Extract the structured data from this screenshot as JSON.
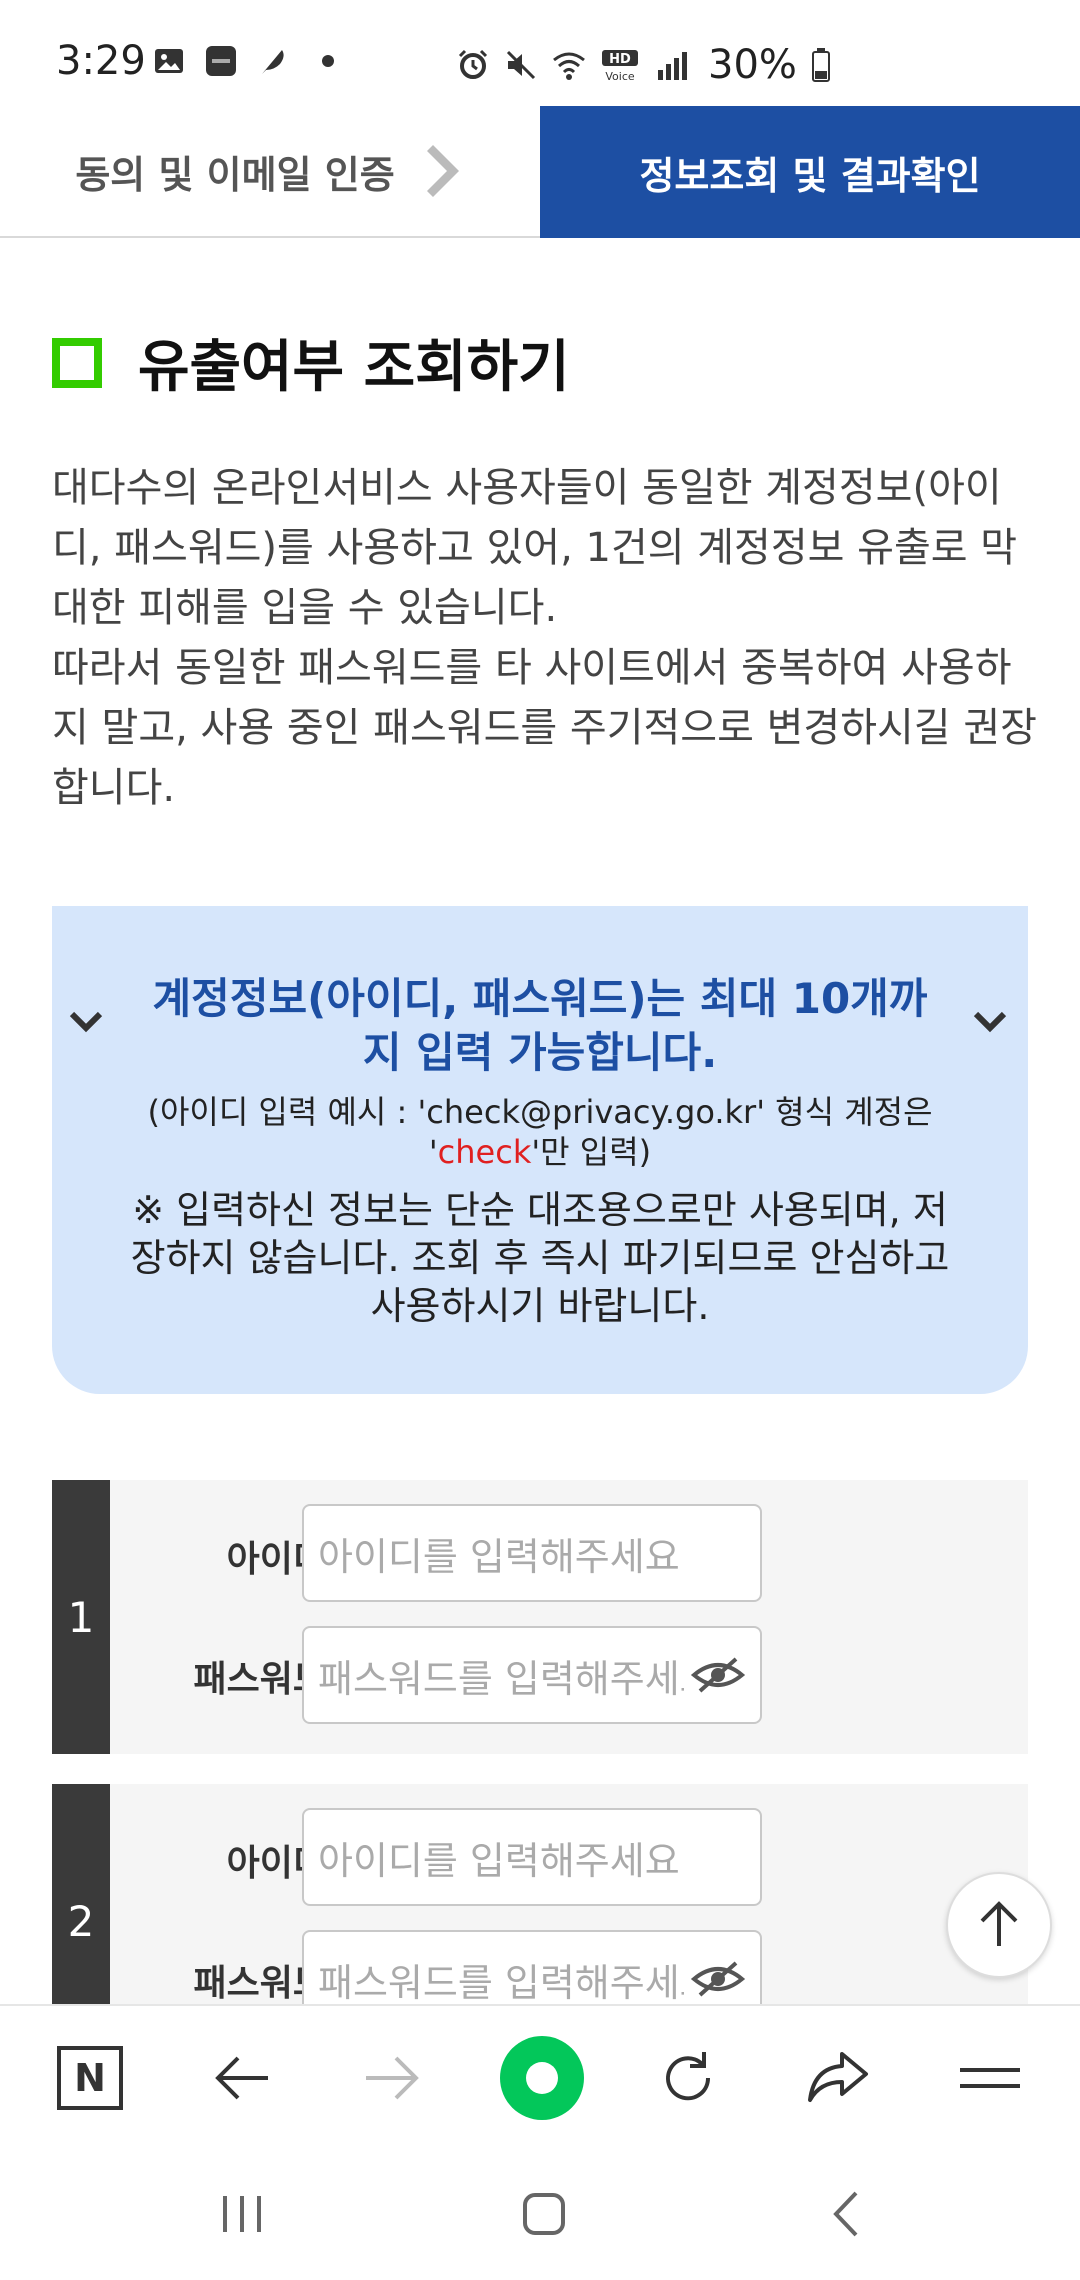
{
  "status_bar": {
    "time": "3:29",
    "battery": "30%",
    "hd_label": "HD",
    "voice_label": "Voice",
    "icons": [
      "gallery-icon",
      "ably-icon",
      "feather-icon",
      "dot-icon",
      "alarm-icon",
      "mute-icon",
      "wifi-icon",
      "hd-voice-icon",
      "signal-icon",
      "battery-icon"
    ]
  },
  "steps": {
    "step1_label": "동의 및 이메일 인증",
    "step2_label": "정보조회 및 결과확인"
  },
  "section": {
    "title": "유출여부 조회하기"
  },
  "description": {
    "paragraph1": "대다수의 온라인서비스 사용자들이 동일한 계정정보(아이디, 패스워드)를 사용하고 있어, 1건의 계정정보 유출로 막대한 피해를 입을 수 있습니다.",
    "paragraph2": "따라서 동일한 패스워드를 타 사이트에서 중복하여 사용하지 말고, 사용 중인 패스워드를 주기적으로 변경하시길 권장합니다."
  },
  "notice": {
    "title": "계정정보(아이디, 패스워드)는 최대 10개까지 입력 가능합니다.",
    "example_prefix": "(아이디 입력 예시 : 'check@privacy.go.kr' 형식 계정은 '",
    "example_highlight": "check",
    "example_suffix": "'만 입력)",
    "warning": "※ 입력하신 정보는 단순 대조용으로만 사용되며, 저장하지 않습니다. 조회 후 즉시 파기되므로 안심하고 사용하시기 바랍니다."
  },
  "accounts": [
    {
      "number": "1",
      "id_label": "아이디",
      "id_placeholder": "아이디를 입력해주세요",
      "pw_label": "패스워드",
      "pw_placeholder": "패스워드를 입력해주세요"
    },
    {
      "number": "2",
      "id_label": "아이디",
      "id_placeholder": "아이디를 입력해주세요",
      "pw_label": "패스워드",
      "pw_placeholder": "패스워드를 입력해주세요"
    }
  ],
  "browser_bar": {
    "icons": [
      "naver-n-icon",
      "back-arrow-icon",
      "forward-arrow-icon",
      "naver-green-circle-icon",
      "reload-icon",
      "share-icon",
      "menu-icon"
    ],
    "naver_letter": "N"
  },
  "colors": {
    "primary": "#1d4fa3",
    "check_green": "#33cc00",
    "notice_bg": "#d6e6fb",
    "highlight_red": "#e02020",
    "naver_green": "#03c75a"
  }
}
